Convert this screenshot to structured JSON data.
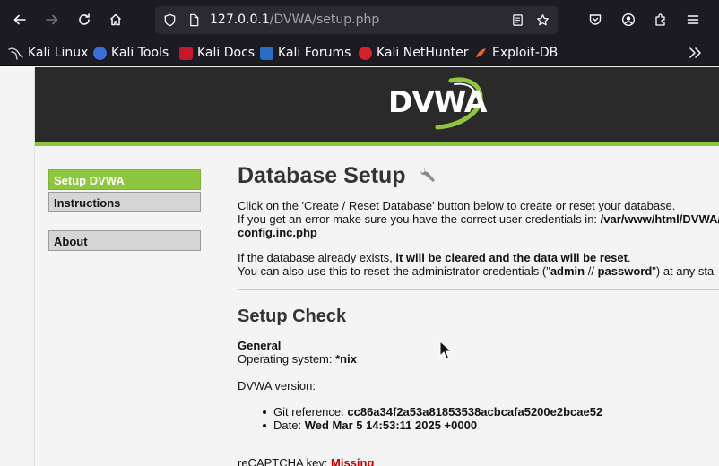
{
  "browser": {
    "url_host": "127.0.0.1",
    "url_path": "/DVWA/setup.php",
    "bookmarks": [
      {
        "label": "Kali Linux",
        "icon": "kali-dragon-icon",
        "color": "#1c1b22"
      },
      {
        "label": "Kali Tools",
        "icon": "kali-tools-icon",
        "color": "#3b6fd6"
      },
      {
        "label": "Kali Docs",
        "icon": "kali-docs-icon",
        "color": "#c2182b"
      },
      {
        "label": "Kali Forums",
        "icon": "kali-forums-icon",
        "color": "#2b6cc4"
      },
      {
        "label": "Kali NetHunter",
        "icon": "kali-nethunter-icon",
        "color": "#d2232a"
      },
      {
        "label": "Exploit-DB",
        "icon": "exploit-db-icon",
        "color": "#e8622c"
      }
    ]
  },
  "header": {
    "logo_text": "DVWA",
    "accent_color": "#8ec63f"
  },
  "menu": {
    "items": [
      {
        "label": "Setup DVWA",
        "selected": true
      },
      {
        "label": "Instructions",
        "selected": false
      },
      {
        "label": "About",
        "selected": false
      }
    ]
  },
  "main": {
    "title": "Database Setup",
    "intro_line1": "Click on the 'Create / Reset Database' button below to create or reset your database.",
    "intro_line2_prefix": "If you get an error make sure you have the correct user credentials in: ",
    "intro_line2_path": "/var/www/html/DVWA/",
    "intro_line3_path": "config.inc.php",
    "reset_line1_prefix": "If the database already exists, ",
    "reset_line1_bold": "it will be cleared and the data will be reset",
    "reset_line1_suffix": ".",
    "reset_line2_prefix": "You can also use this to reset the administrator credentials (\"",
    "reset_line2_user": "admin",
    "reset_line2_sep": " // ",
    "reset_line2_pass": "password",
    "reset_line2_suffix": "\") at any sta",
    "setup_check_title": "Setup Check",
    "general_label": "General",
    "os_prefix": "Operating system: ",
    "os_value": "*nix",
    "version_label": "DVWA version:",
    "git_prefix": "Git reference: ",
    "git_value": "cc86a34f2a53a81853538acbcafa5200e2bcae52",
    "date_prefix": "Date: ",
    "date_value": "Wed Mar 5 14:53:11 2025 +0000",
    "recaptcha_prefix": "reCAPTCHA key: ",
    "recaptcha_value": "Missing"
  }
}
